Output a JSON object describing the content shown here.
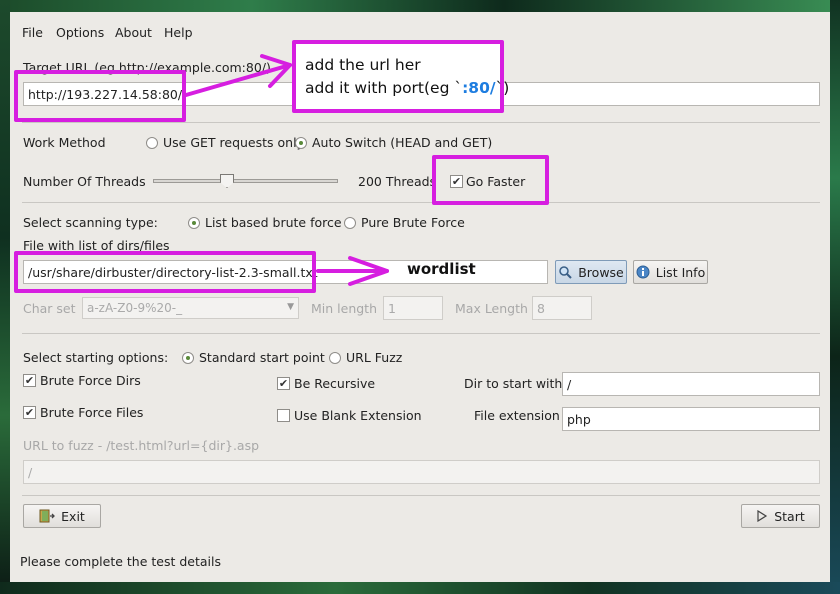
{
  "menu": [
    "File",
    "Options",
    "About",
    "Help"
  ],
  "target": {
    "label": "Target URL (eg http://example.com:80/)",
    "value": "http://193.227.14.58:80/"
  },
  "work_method": {
    "label": "Work Method",
    "option_get": "Use GET requests only",
    "option_auto": "Auto Switch (HEAD and GET)"
  },
  "threads": {
    "label": "Number Of Threads",
    "value_text": "200 Threads",
    "go_faster": "Go Faster",
    "slider_fraction": 0.4
  },
  "scan": {
    "label": "Select scanning type:",
    "option_list": "List based brute force",
    "option_pure": "Pure Brute Force",
    "file_label": "File with list of dirs/files",
    "file_value": "/usr/share/dirbuster/directory-list-2.3-small.txt",
    "browse": "Browse",
    "list_info": "List Info"
  },
  "charset": {
    "label": "Char set",
    "value": "a-zA-Z0-9%20-_",
    "min_label": "Min length",
    "min_value": "1",
    "max_label": "Max Length",
    "max_value": "8"
  },
  "start": {
    "label": "Select starting options:",
    "option_standard": "Standard start point",
    "option_fuzz": "URL Fuzz",
    "brute_dirs": "Brute Force Dirs",
    "brute_files": "Brute Force Files",
    "be_recursive": "Be Recursive",
    "blank_ext": "Use Blank Extension",
    "dir_label": "Dir to start with",
    "dir_value": "/",
    "ext_label": "File extension",
    "ext_value": "php",
    "fuzz_label": "URL to fuzz - /test.html?url={dir}.asp",
    "fuzz_value": "/"
  },
  "buttons": {
    "exit": "Exit",
    "start": "Start"
  },
  "status": "Please complete the test details",
  "annotations": {
    "url_line1": "add the url her",
    "url_line2_prefix": "add it with port(eg `",
    "url_line2_port": ":80/",
    "url_line2_suffix": "`)",
    "wordlist": "wordlist"
  },
  "colors": {
    "annotation": "#d61ee0",
    "port": "#1e7de0"
  }
}
